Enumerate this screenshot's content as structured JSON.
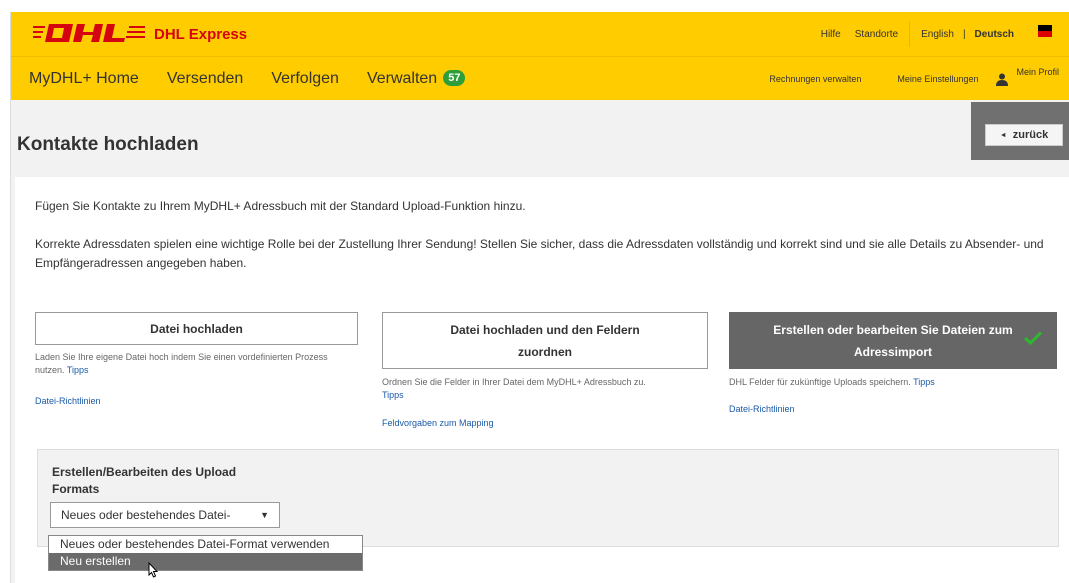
{
  "header": {
    "brand": "DHL Express",
    "links": {
      "help": "Hilfe",
      "locations": "Standorte",
      "english": "English",
      "german": "Deutsch"
    },
    "flag_colors": [
      "#000000",
      "#dd0000",
      "#ffce00"
    ]
  },
  "nav": {
    "items": [
      "MyDHL+ Home",
      "Versenden",
      "Verfolgen",
      "Verwalten"
    ],
    "badge": "57",
    "right": {
      "invoices": "Rechnungen verwalten",
      "settings": "Meine Einstellungen",
      "profile": "Mein Profil"
    }
  },
  "page": {
    "title": "Kontakte hochladen",
    "back": "zurück",
    "intro": "Fügen Sie Kontakte zu Ihrem MyDHL+ Adressbuch mit der Standard Upload-Funktion hinzu.",
    "intro2": "Korrekte Adressdaten spielen eine wichtige Rolle bei der Zustellung Ihrer Sendung! Stellen Sie sicher, dass die Adressdaten vollständig und korrekt sind und sie alle Details zu Absender- und Empfängeradressen angegeben haben."
  },
  "options": {
    "upload": {
      "label": "Datei hochladen",
      "desc": "Laden Sie Ihre eigene Datei hoch indem Sie einen vordefinierten Prozess nutzen.",
      "tips": "Tipps",
      "link": "Datei-Richtlinien"
    },
    "map": {
      "label_line1": "Datei hochladen und den Feldern",
      "label_line2": "zuordnen",
      "desc": "Ordnen Sie die Felder in Ihrer Datei dem MyDHL+ Adressbuch zu.",
      "tips": "Tipps",
      "link": "Feldvorgaben zum Mapping"
    },
    "create": {
      "label_line1": "Erstellen oder bearbeiten Sie Dateien zum",
      "label_line2": "Adressimport",
      "desc": "DHL Felder für zukünftige Uploads speichern.",
      "tips": "Tipps",
      "link": "Datei-Richtlinien"
    }
  },
  "format_panel": {
    "label_line1": "Erstellen/Bearbeiten des Upload",
    "label_line2": "Formats",
    "selected": "Neues oder bestehendes Datei-",
    "options": [
      "Neues oder bestehendes Datei-Format verwenden",
      "Neu erstellen"
    ],
    "highlighted_index": 1
  }
}
